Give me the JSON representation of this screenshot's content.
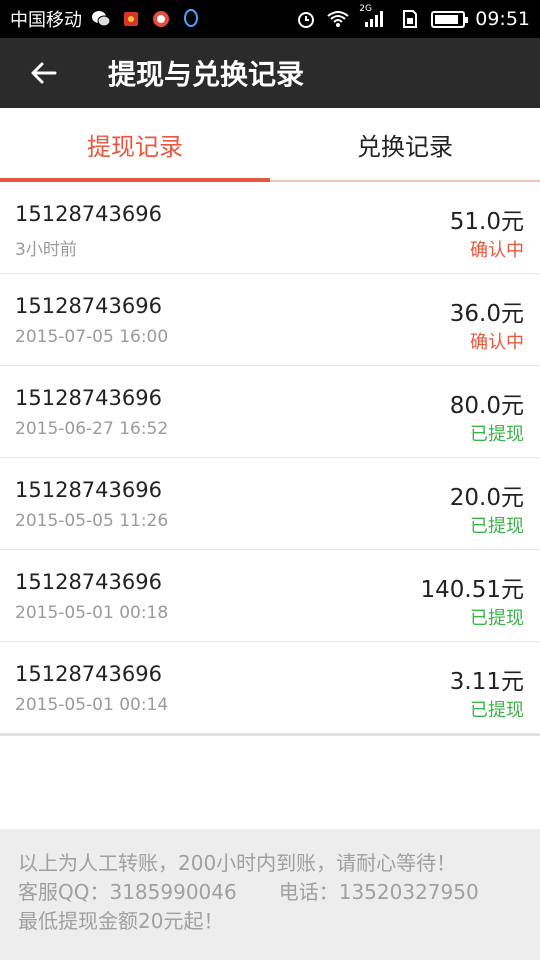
{
  "status_bar": {
    "carrier": "中国移动",
    "network": "2G",
    "time": "09:51",
    "battery_level": 0.9,
    "left_icons": [
      "wechat-icon",
      "red-packet-icon",
      "app-icon",
      "qq-icon"
    ]
  },
  "app_bar": {
    "title": "提现与兑换记录"
  },
  "tabs": [
    {
      "label": "提现记录",
      "active": true
    },
    {
      "label": "兑换记录",
      "active": false
    }
  ],
  "records": [
    {
      "phone": "15128743696",
      "time": "3小时前",
      "amount": "51.0元",
      "status": "确认中",
      "state": "pending"
    },
    {
      "phone": "15128743696",
      "time": "2015-07-05 16:00",
      "amount": "36.0元",
      "status": "确认中",
      "state": "pending"
    },
    {
      "phone": "15128743696",
      "time": "2015-06-27 16:52",
      "amount": "80.0元",
      "status": "已提现",
      "state": "done"
    },
    {
      "phone": "15128743696",
      "time": "2015-05-05 11:26",
      "amount": "20.0元",
      "status": "已提现",
      "state": "done"
    },
    {
      "phone": "15128743696",
      "time": "2015-05-01 00:18",
      "amount": "140.51元",
      "status": "已提现",
      "state": "done"
    },
    {
      "phone": "15128743696",
      "time": "2015-05-01 00:14",
      "amount": "3.11元",
      "status": "已提现",
      "state": "done"
    }
  ],
  "footer": {
    "notice": "以上为人工转账，200小时内到账，请耐心等待！",
    "qq": "客服QQ：3185990046",
    "phone": "电话：13520327950",
    "min_withdraw": "最低提现金额20元起！"
  },
  "colors": {
    "accent": "#e9573f",
    "success": "#3cb44a",
    "app_bar": "#2b2b2b"
  }
}
